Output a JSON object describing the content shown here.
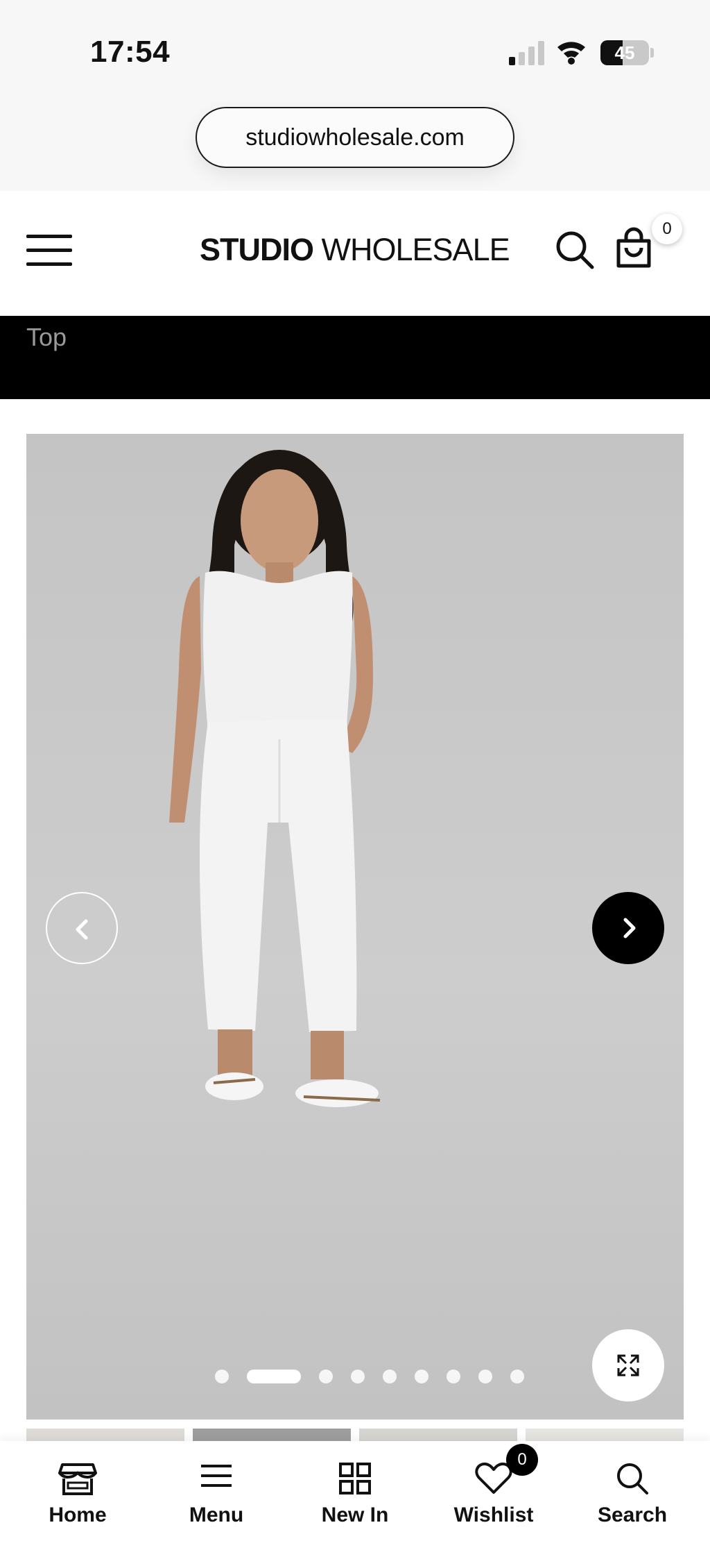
{
  "status_bar": {
    "time": "17:54",
    "battery_percent": "45",
    "signal_bars_on": 1,
    "signal_bars_total": 4,
    "icons": [
      "signal-icon",
      "wifi-icon",
      "battery-icon"
    ]
  },
  "browser": {
    "url": "studiowholesale.com"
  },
  "header": {
    "logo_bold": "STUDIO",
    "logo_light": "WHOLESALE",
    "cart_count": "0",
    "icons": [
      "hamburger-menu-icon",
      "search-icon",
      "shopping-bag-icon"
    ]
  },
  "breadcrumb": {
    "text": "Top"
  },
  "gallery": {
    "slide_count": 9,
    "active_slide": 2,
    "colors": {
      "background": "#c8c8c8",
      "next_button": "#000000",
      "prev_border": "#ffffff"
    },
    "icons": [
      "chevron-left-icon",
      "chevron-right-icon",
      "expand-icon"
    ]
  },
  "bottom_nav": {
    "items": [
      {
        "label": "Home",
        "icon": "storefront-icon"
      },
      {
        "label": "Menu",
        "icon": "menu-icon"
      },
      {
        "label": "New In",
        "icon": "grid-icon"
      },
      {
        "label": "Wishlist",
        "icon": "heart-icon"
      },
      {
        "label": "Search",
        "icon": "search-icon"
      }
    ],
    "wishlist_count": "0"
  }
}
